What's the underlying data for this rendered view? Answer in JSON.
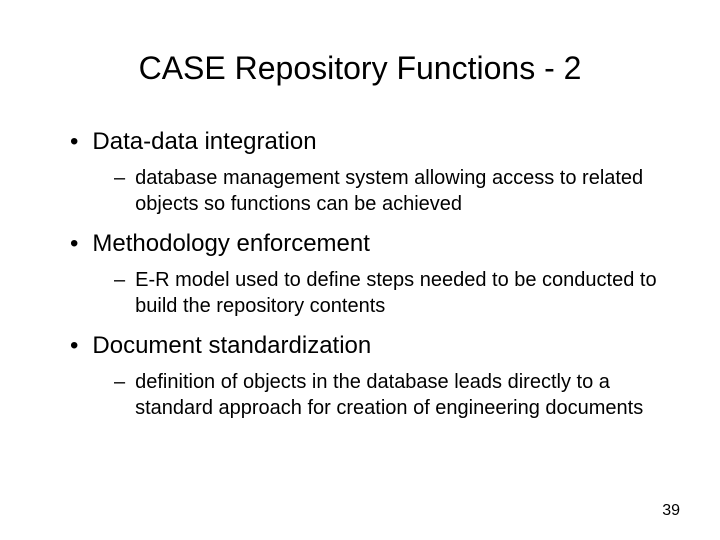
{
  "title": "CASE Repository Functions - 2",
  "items": [
    {
      "text": "Data-data integration",
      "sub": "database management system allowing access to related objects so functions can be achieved"
    },
    {
      "text": "Methodology enforcement",
      "sub": "E-R model used to define steps needed to be conducted to build the repository contents"
    },
    {
      "text": "Document standardization",
      "sub": "definition of objects in the database leads directly to a standard approach for creation of engineering documents"
    }
  ],
  "page_number": "39",
  "bullet_char": "•",
  "dash_char": "–"
}
